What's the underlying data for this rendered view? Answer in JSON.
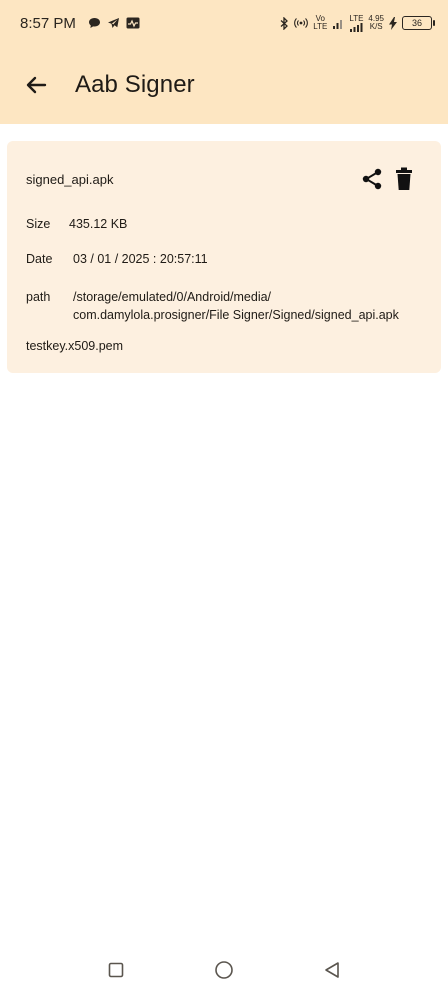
{
  "status_bar": {
    "time": "8:57 PM",
    "notification_icons": [
      "chat-bubble-icon",
      "telegram-icon",
      "activity-icon"
    ],
    "right_icons": [
      "bluetooth-icon",
      "hotspot-icon",
      "volte-icon",
      "signal-icon",
      "lte-signal-icon",
      "charging-icon"
    ],
    "volte_top": "Vo",
    "volte_bottom": "LTE",
    "lte_label": "LTE",
    "speed_value": "4.95",
    "speed_unit": "K/S",
    "battery": "36"
  },
  "app_bar": {
    "back_icon": "arrow-back-icon",
    "title": "Aab Signer",
    "background": "#fde6c2"
  },
  "file_card": {
    "background": "#fdf0e0",
    "file_name": "signed_api.apk",
    "share_icon": "share-icon",
    "delete_icon": "trash-icon",
    "size_label": "Size",
    "size_value": "435.12 KB",
    "date_label": "Date",
    "date_value": "03 / 01 / 2025 : 20:57:11",
    "path_label": "path",
    "path_value": "/storage/emulated/0/Android/media/\ncom.damylola.prosigner/File Signer/Signed/signed_api.apk",
    "key_file": "testkey.x509.pem"
  },
  "nav_bar": {
    "items": [
      "recents-square-icon",
      "home-circle-icon",
      "back-triangle-icon"
    ]
  }
}
